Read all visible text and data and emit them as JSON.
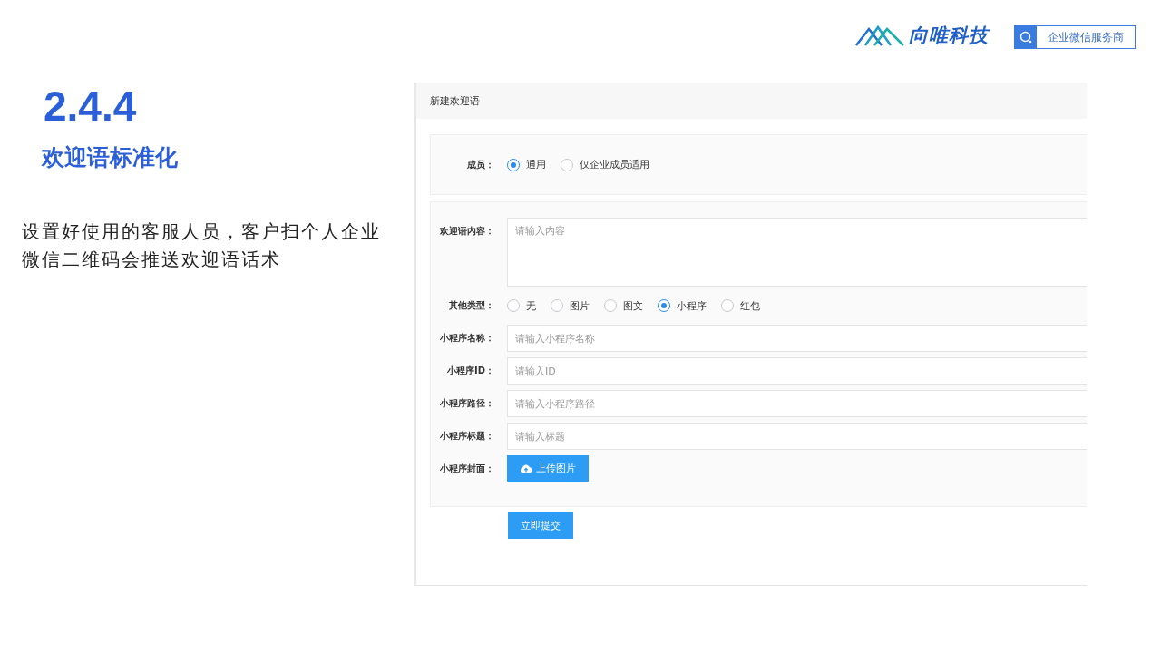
{
  "header": {
    "brand": "向唯科技",
    "badge": "企业微信服务商"
  },
  "slide": {
    "number": "2.4.4",
    "title": "欢迎语标准化",
    "description": "设置好使用的客服人员，客户扫个人企业微信二维码会推送欢迎语话术"
  },
  "form": {
    "title": "新建欢迎语",
    "member": {
      "label": "成员：",
      "options": [
        {
          "label": "通用",
          "selected": true
        },
        {
          "label": "仅企业成员适用",
          "selected": false
        }
      ]
    },
    "content": {
      "label": "欢迎语内容：",
      "placeholder": "请输入内容"
    },
    "other_type": {
      "label": "其他类型：",
      "options": [
        {
          "label": "无",
          "selected": false
        },
        {
          "label": "图片",
          "selected": false
        },
        {
          "label": "图文",
          "selected": false
        },
        {
          "label": "小程序",
          "selected": true
        },
        {
          "label": "红包",
          "selected": false
        }
      ]
    },
    "fields": [
      {
        "label": "小程序名称：",
        "placeholder": "请输入小程序名称"
      },
      {
        "label": "小程序ID：",
        "placeholder": "请输入ID"
      },
      {
        "label": "小程序路径：",
        "placeholder": "请输入小程序路径"
      },
      {
        "label": "小程序标题：",
        "placeholder": "请输入标题"
      }
    ],
    "cover": {
      "label": "小程序封面：",
      "button": "上传图片"
    },
    "submit": "立即提交"
  }
}
